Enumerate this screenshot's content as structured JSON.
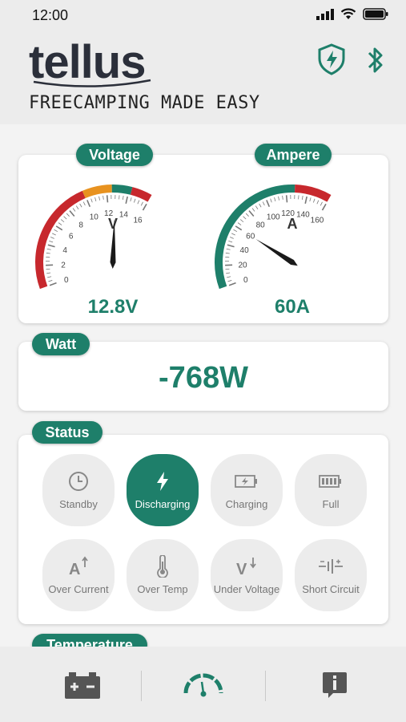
{
  "status_bar": {
    "time": "12:00"
  },
  "header": {
    "logo": "tellus",
    "tagline": "FREECAMPING MADE EASY",
    "colors": {
      "accent": "#1e7f6a"
    }
  },
  "voltage": {
    "label": "Voltage",
    "unit": "V",
    "ticks": [
      "0",
      "2",
      "4",
      "6",
      "8",
      "10",
      "12",
      "14",
      "16"
    ],
    "range": [
      0,
      16
    ],
    "needle_value": 12.8,
    "value": "12.8V"
  },
  "ampere": {
    "label": "Ampere",
    "unit": "A",
    "ticks": [
      "0",
      "20",
      "40",
      "60",
      "80",
      "100",
      "120",
      "140",
      "160"
    ],
    "range": [
      0,
      160
    ],
    "needle_value": 60,
    "value": "60A"
  },
  "watt": {
    "label": "Watt",
    "value": "-768W"
  },
  "status": {
    "label": "Status",
    "items": [
      {
        "label": "Standby",
        "icon": "clock-icon",
        "active": false
      },
      {
        "label": "Discharging",
        "icon": "lightning-icon",
        "active": true
      },
      {
        "label": "Charging",
        "icon": "battery-charging-icon",
        "active": false
      },
      {
        "label": "Full",
        "icon": "battery-full-icon",
        "active": false
      },
      {
        "label": "Over Current",
        "icon": "over-current-icon",
        "active": false
      },
      {
        "label": "Over Temp",
        "icon": "thermometer-icon",
        "active": false
      },
      {
        "label": "Under Voltage",
        "icon": "under-voltage-icon",
        "active": false
      },
      {
        "label": "Short Circuit",
        "icon": "short-circuit-icon",
        "active": false
      }
    ]
  },
  "temperature": {
    "label": "Temperature"
  },
  "bottom_nav": [
    {
      "name": "battery-icon"
    },
    {
      "name": "gauge-icon",
      "active": true
    },
    {
      "name": "info-icon"
    }
  ]
}
